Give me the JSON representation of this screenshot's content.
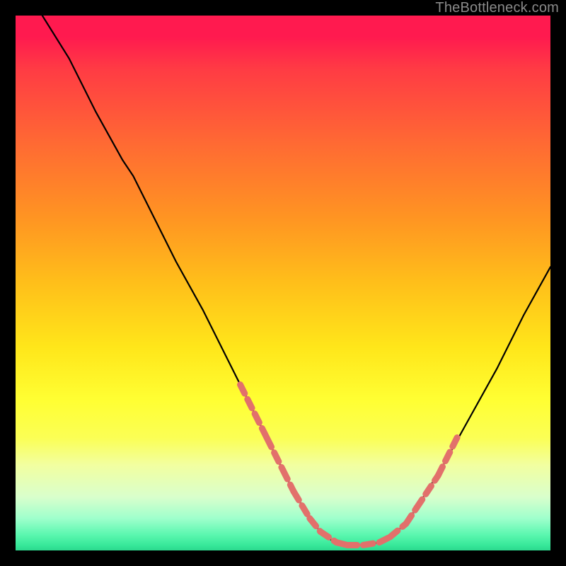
{
  "watermark": "TheBottleneck.com",
  "chart_data": {
    "type": "line",
    "title": "",
    "xlabel": "",
    "ylabel": "",
    "xlim": [
      0,
      100
    ],
    "ylim": [
      0,
      100
    ],
    "grid": false,
    "series": [
      {
        "name": "curve",
        "x": [
          5,
          10,
          15,
          20,
          22,
          25,
          30,
          35,
          40,
          45,
          47,
          50,
          52,
          55,
          57,
          58,
          60,
          62,
          65,
          68,
          70,
          73,
          75,
          80,
          85,
          90,
          95,
          100
        ],
        "y": [
          100,
          92,
          82,
          73,
          70,
          64,
          54,
          45,
          35,
          25,
          21,
          15,
          11,
          6,
          3.5,
          2.5,
          1.5,
          1,
          1,
          1.5,
          2.5,
          5,
          8,
          16,
          25,
          34,
          44,
          53
        ]
      },
      {
        "name": "highlight-segments",
        "segments": [
          {
            "x": [
              42,
              47
            ],
            "y": [
              31,
              21
            ]
          },
          {
            "x": [
              47,
              50
            ],
            "y": [
              21,
              15
            ]
          },
          {
            "x": [
              50,
              52
            ],
            "y": [
              15,
              11
            ]
          },
          {
            "x": [
              52,
              55
            ],
            "y": [
              11,
              6
            ]
          },
          {
            "x": [
              55,
              57
            ],
            "y": [
              6,
              3.5
            ]
          },
          {
            "x": [
              57,
              60
            ],
            "y": [
              3.5,
              1.5
            ]
          },
          {
            "x": [
              60,
              62
            ],
            "y": [
              1.5,
              1
            ]
          },
          {
            "x": [
              62,
              65
            ],
            "y": [
              1,
              1
            ]
          },
          {
            "x": [
              65,
              68
            ],
            "y": [
              1,
              1.5
            ]
          },
          {
            "x": [
              68,
              70
            ],
            "y": [
              1.5,
              2.5
            ]
          },
          {
            "x": [
              70,
              73
            ],
            "y": [
              2.5,
              5
            ]
          },
          {
            "x": [
              73,
              75
            ],
            "y": [
              5,
              8
            ]
          },
          {
            "x": [
              75,
              79
            ],
            "y": [
              8,
              14
            ]
          },
          {
            "x": [
              79,
              83
            ],
            "y": [
              14,
              22
            ]
          }
        ]
      }
    ],
    "colors": {
      "curve": "#000000",
      "highlight": "#e2706b",
      "gradient_top": "#ff1a4f",
      "gradient_bottom": "#2bd98e",
      "frame": "#000000"
    }
  }
}
